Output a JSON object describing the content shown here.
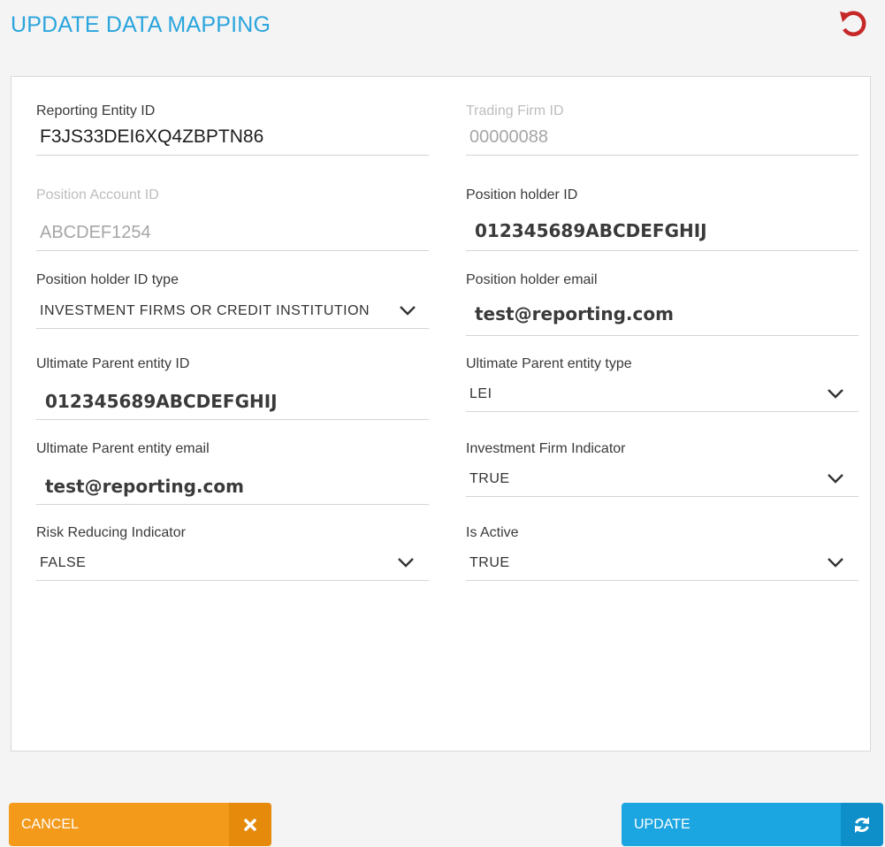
{
  "header": {
    "title": "UPDATE DATA MAPPING"
  },
  "form": {
    "reporting_entity_id": {
      "label": "Reporting Entity ID",
      "value": "F3JS33DEI6XQ4ZBPTN86"
    },
    "trading_firm_id": {
      "label": "Trading Firm ID",
      "value": "00000088"
    },
    "position_account_id": {
      "label": "Position Account ID",
      "value": "ABCDEF1254"
    },
    "position_holder_id": {
      "label": "Position holder ID",
      "value": "012345689ABCDEFGHIJ"
    },
    "position_holder_id_type": {
      "label": "Position holder ID type",
      "value": "INVESTMENT FIRMS OR CREDIT INSTITUTION"
    },
    "position_holder_email": {
      "label": "Position holder email",
      "value": "test@reporting.com"
    },
    "ultimate_parent_entity_id": {
      "label": "Ultimate Parent entity ID",
      "value": "012345689ABCDEFGHIJ"
    },
    "ultimate_parent_entity_type": {
      "label": "Ultimate Parent entity type",
      "value": "LEI"
    },
    "ultimate_parent_entity_email": {
      "label": "Ultimate Parent entity email",
      "value": "test@reporting.com"
    },
    "investment_firm_indicator": {
      "label": "Investment Firm Indicator",
      "value": "TRUE"
    },
    "risk_reducing_indicator": {
      "label": "Risk Reducing Indicator",
      "value": "FALSE"
    },
    "is_active": {
      "label": "Is Active",
      "value": "TRUE"
    }
  },
  "footer": {
    "cancel_label": "CANCEL",
    "update_label": "UPDATE"
  },
  "icons": {
    "reset": "reset-icon",
    "close": "close-icon",
    "refresh": "refresh-icon",
    "chevron": "chevron-down-icon"
  },
  "colors": {
    "title": "#2aa5dd",
    "reset": "#c62828",
    "cancel": "#f39a1b",
    "update": "#1ba5e1"
  }
}
